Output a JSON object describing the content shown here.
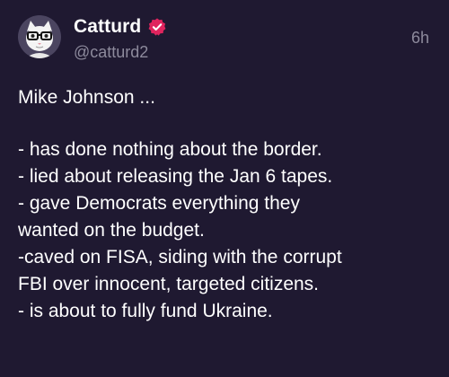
{
  "author": {
    "display_name": "Catturd",
    "handle": "@catturd2",
    "verified_color": "#e0245e"
  },
  "timestamp": "6h",
  "tweet": {
    "lines": [
      "Mike Johnson ...",
      "",
      "- has done nothing about the border.",
      "- lied about releasing the Jan 6 tapes.",
      "- gave Democrats everything they",
      "wanted on the budget.",
      "-caved on FISA, siding with the corrupt",
      "FBI over innocent, targeted citizens.",
      "- is about to fully fund Ukraine."
    ]
  }
}
